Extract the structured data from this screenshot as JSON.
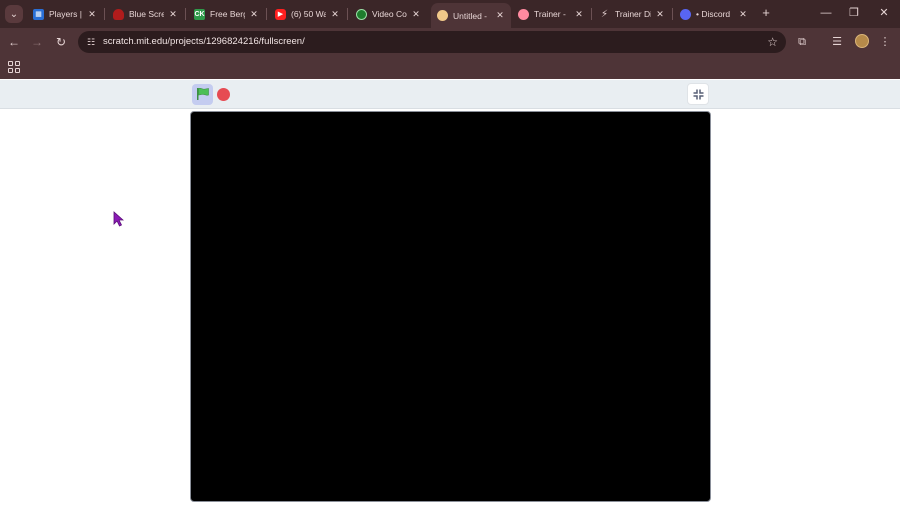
{
  "tabs": [
    {
      "title": "Players | A",
      "favicon": "grid-favicon",
      "color": "#2a6fd6",
      "active": false
    },
    {
      "title": "Blue Scre",
      "favicon": "red-favicon",
      "color": "#b01c1c",
      "active": false
    },
    {
      "title": "Free Berg",
      "favicon": "ck-favicon",
      "color": "#2f9a4a",
      "active": false
    },
    {
      "title": "(6) 50 Wa",
      "favicon": "youtube-favicon",
      "color": "#ff1f1f",
      "active": false
    },
    {
      "title": "Video Co",
      "favicon": "green-circle-favicon",
      "color": "#1e7d2d",
      "active": false
    },
    {
      "title": "Untitled -",
      "favicon": "doc-favicon",
      "color": "#f0c889",
      "active": true
    },
    {
      "title": "Trainer - ",
      "favicon": "trainer-favicon",
      "color": "#ff8aa0",
      "active": false
    },
    {
      "title": "Trainer Di",
      "favicon": "bolt-favicon",
      "color": "#e6d4d4",
      "active": false
    },
    {
      "title": "• Discord",
      "favicon": "discord-favicon",
      "color": "#5865f2",
      "active": false
    }
  ],
  "toolbar": {
    "url": "scratch.mit.edu/projects/1296824216/fullscreen/"
  },
  "colors": {
    "tab_strip": "#3b2628",
    "toolbar": "#4e3437",
    "scratch_bar": "#e9eef2",
    "stage": "#000000",
    "stop": "#e64b53",
    "flag": "#4cbf56"
  }
}
